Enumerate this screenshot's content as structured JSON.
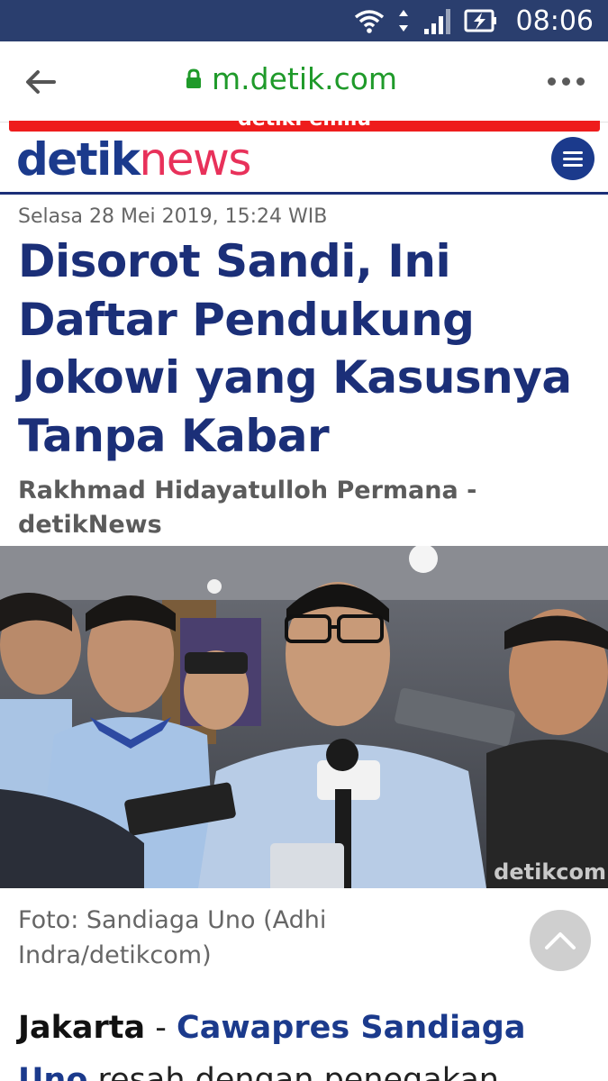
{
  "status_bar": {
    "time": "08:06",
    "icons": [
      "wifi-icon",
      "data-arrows-icon",
      "signal-icon",
      "battery-charging-icon"
    ]
  },
  "browser": {
    "url": "m.detik.com",
    "icons": [
      "back-arrow-icon",
      "lock-icon",
      "more-dots-icon"
    ]
  },
  "banner": {
    "label": "detikPemilu"
  },
  "header": {
    "logo_part1": "detik",
    "logo_part2": "news",
    "menu_icon": "hamburger-menu-icon"
  },
  "article": {
    "date": "Selasa 28 Mei 2019, 15:24 WIB",
    "title": "Disorot Sandi, Ini Daftar Pendukung Jokowi yang Kasusnya Tanpa Kabar",
    "author": "Rakhmad Hidayatulloh Permana - detikNews",
    "photo_watermark": "detikcom",
    "caption": "Foto: Sandiaga Uno (Adhi Indra/detikcom)",
    "body_city": "Jakarta",
    "body_dash": " - ",
    "body_link": "Cawapres Sandiaga Uno",
    "body_text": " resah dengan penegakan"
  },
  "colors": {
    "status_bar": "#2a3e6e",
    "url_green": "#1f9a2a",
    "brand_blue": "#1b3a8c",
    "brand_pink": "#e8315a",
    "banner_red": "#ee1c1c"
  }
}
